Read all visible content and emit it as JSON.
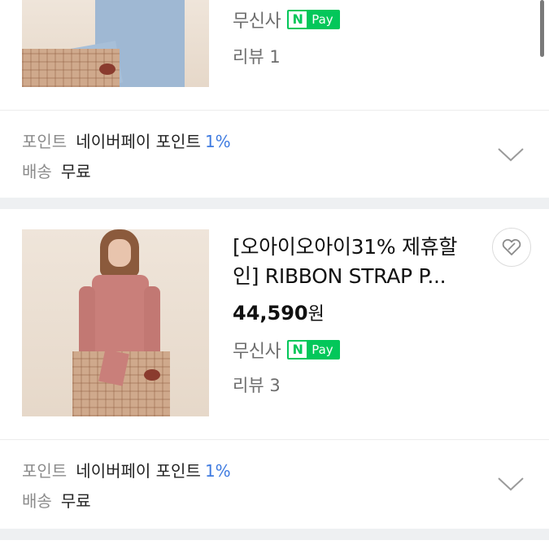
{
  "products": [
    {
      "seller": "무신사",
      "pay_badge": {
        "letter": "N",
        "text": "Pay"
      },
      "review_label": "리뷰",
      "review_count": "1",
      "point_label": "포인트",
      "point_desc": "네이버페이 포인트",
      "point_rate": "1%",
      "shipping_label": "배송",
      "shipping_value": "무료"
    },
    {
      "title_line1": "[오아이오아이31% 제휴할",
      "title_line2": "인] RIBBON STRAP P...",
      "price": "44,590",
      "price_unit": "원",
      "seller": "무신사",
      "pay_badge": {
        "letter": "N",
        "text": "Pay"
      },
      "review_label": "리뷰",
      "review_count": "3",
      "point_label": "포인트",
      "point_desc": "네이버페이 포인트",
      "point_rate": "1%",
      "shipping_label": "배송",
      "shipping_value": "무료"
    }
  ],
  "icons": {
    "wishlist": "heart-icon",
    "expand": "chevron-down-icon"
  },
  "colors": {
    "npay_green": "#03c75a",
    "point_blue": "#3f7be0",
    "band": "#eef0f2"
  }
}
